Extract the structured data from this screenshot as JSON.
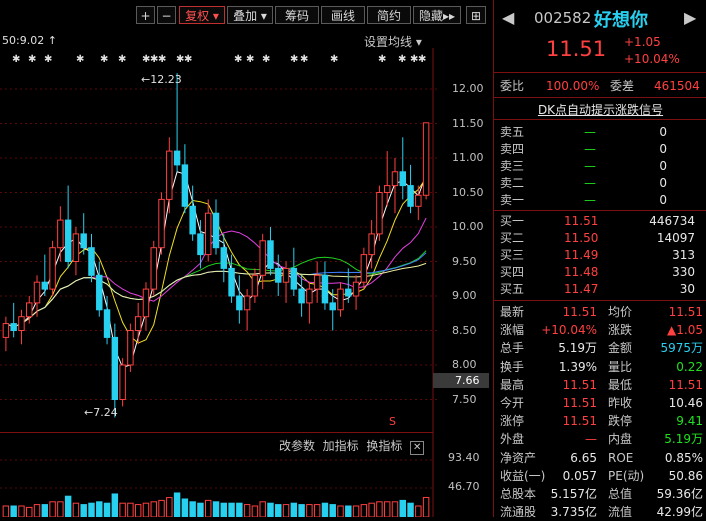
{
  "toolbar": {
    "zoom_in": "+",
    "zoom_out": "−",
    "fuquan": "复权",
    "diejia": "叠加",
    "chouma": "筹码",
    "huaxian": "画线",
    "jianyue": "简约",
    "yincang": "隐藏",
    "more": "▸▸",
    "layout": "⊞"
  },
  "chart": {
    "ma_label": "50:9.02",
    "ma_setting": "设置均线",
    "high_label": "12.23",
    "low_label": "7.24",
    "current_price_box": "7.66",
    "y_ticks": [
      "12.00",
      "11.50",
      "11.00",
      "10.50",
      "10.00",
      "9.50",
      "9.00",
      "8.50",
      "8.00",
      "7.50"
    ],
    "indicator_bar": [
      "改参数",
      "加指标",
      "换指标"
    ],
    "vol_ticks": [
      "93.40",
      "46.70"
    ],
    "s_marker": "S"
  },
  "chart_data": {
    "type": "candlestick",
    "title": "",
    "ylim": [
      7.0,
      12.5
    ],
    "annotations": [
      {
        "label": "12.23",
        "value": 12.23
      },
      {
        "label": "7.24",
        "value": 7.24
      }
    ],
    "candles": [
      {
        "o": 8.4,
        "h": 8.7,
        "l": 8.2,
        "c": 8.6
      },
      {
        "o": 8.6,
        "h": 8.9,
        "l": 8.4,
        "c": 8.5
      },
      {
        "o": 8.5,
        "h": 8.8,
        "l": 8.3,
        "c": 8.7
      },
      {
        "o": 8.7,
        "h": 9.0,
        "l": 8.6,
        "c": 8.9
      },
      {
        "o": 8.9,
        "h": 9.3,
        "l": 8.7,
        "c": 9.2
      },
      {
        "o": 9.2,
        "h": 9.6,
        "l": 9.0,
        "c": 9.1
      },
      {
        "o": 9.1,
        "h": 9.8,
        "l": 9.0,
        "c": 9.7
      },
      {
        "o": 9.7,
        "h": 10.3,
        "l": 9.5,
        "c": 10.1
      },
      {
        "o": 10.1,
        "h": 10.6,
        "l": 9.4,
        "c": 9.5
      },
      {
        "o": 9.5,
        "h": 10.0,
        "l": 9.3,
        "c": 9.9
      },
      {
        "o": 9.9,
        "h": 10.2,
        "l": 9.6,
        "c": 9.7
      },
      {
        "o": 9.7,
        "h": 9.9,
        "l": 9.2,
        "c": 9.3
      },
      {
        "o": 9.3,
        "h": 9.5,
        "l": 8.7,
        "c": 8.8
      },
      {
        "o": 8.8,
        "h": 9.0,
        "l": 8.3,
        "c": 8.4
      },
      {
        "o": 8.4,
        "h": 8.6,
        "l": 7.24,
        "c": 7.5
      },
      {
        "o": 7.5,
        "h": 8.1,
        "l": 7.4,
        "c": 8.0
      },
      {
        "o": 8.0,
        "h": 8.6,
        "l": 7.9,
        "c": 8.5
      },
      {
        "o": 8.5,
        "h": 8.9,
        "l": 8.3,
        "c": 8.7
      },
      {
        "o": 8.7,
        "h": 9.2,
        "l": 8.5,
        "c": 9.1
      },
      {
        "o": 9.1,
        "h": 9.8,
        "l": 9.0,
        "c": 9.7
      },
      {
        "o": 9.7,
        "h": 10.5,
        "l": 9.6,
        "c": 10.4
      },
      {
        "o": 10.4,
        "h": 11.3,
        "l": 10.2,
        "c": 11.1
      },
      {
        "o": 11.1,
        "h": 12.23,
        "l": 10.8,
        "c": 10.9
      },
      {
        "o": 10.9,
        "h": 11.2,
        "l": 10.2,
        "c": 10.3
      },
      {
        "o": 10.3,
        "h": 10.6,
        "l": 9.8,
        "c": 9.9
      },
      {
        "o": 9.9,
        "h": 10.1,
        "l": 9.4,
        "c": 9.6
      },
      {
        "o": 9.6,
        "h": 10.4,
        "l": 9.5,
        "c": 10.2
      },
      {
        "o": 10.2,
        "h": 10.4,
        "l": 9.6,
        "c": 9.7
      },
      {
        "o": 9.7,
        "h": 9.9,
        "l": 9.2,
        "c": 9.4
      },
      {
        "o": 9.4,
        "h": 9.6,
        "l": 8.9,
        "c": 9.0
      },
      {
        "o": 9.0,
        "h": 9.3,
        "l": 8.6,
        "c": 8.8
      },
      {
        "o": 8.8,
        "h": 9.1,
        "l": 8.5,
        "c": 9.0
      },
      {
        "o": 9.0,
        "h": 9.4,
        "l": 8.9,
        "c": 9.3
      },
      {
        "o": 9.3,
        "h": 9.9,
        "l": 9.1,
        "c": 9.8
      },
      {
        "o": 9.8,
        "h": 10.0,
        "l": 9.3,
        "c": 9.4
      },
      {
        "o": 9.4,
        "h": 9.6,
        "l": 9.0,
        "c": 9.2
      },
      {
        "o": 9.2,
        "h": 9.5,
        "l": 8.9,
        "c": 9.4
      },
      {
        "o": 9.4,
        "h": 9.7,
        "l": 9.0,
        "c": 9.1
      },
      {
        "o": 9.1,
        "h": 9.3,
        "l": 8.7,
        "c": 8.9
      },
      {
        "o": 8.9,
        "h": 9.2,
        "l": 8.6,
        "c": 9.1
      },
      {
        "o": 9.1,
        "h": 9.5,
        "l": 8.9,
        "c": 9.3
      },
      {
        "o": 9.3,
        "h": 9.5,
        "l": 8.8,
        "c": 8.9
      },
      {
        "o": 8.9,
        "h": 9.1,
        "l": 8.5,
        "c": 8.8
      },
      {
        "o": 8.8,
        "h": 9.2,
        "l": 8.7,
        "c": 9.1
      },
      {
        "o": 9.1,
        "h": 9.4,
        "l": 8.9,
        "c": 9.0
      },
      {
        "o": 9.0,
        "h": 9.3,
        "l": 8.8,
        "c": 9.2
      },
      {
        "o": 9.2,
        "h": 9.7,
        "l": 9.1,
        "c": 9.6
      },
      {
        "o": 9.6,
        "h": 10.1,
        "l": 9.4,
        "c": 9.9
      },
      {
        "o": 9.9,
        "h": 10.6,
        "l": 9.8,
        "c": 10.5
      },
      {
        "o": 10.5,
        "h": 11.1,
        "l": 10.3,
        "c": 10.6
      },
      {
        "o": 10.6,
        "h": 11.0,
        "l": 10.2,
        "c": 10.8
      },
      {
        "o": 10.8,
        "h": 11.3,
        "l": 10.4,
        "c": 10.6
      },
      {
        "o": 10.6,
        "h": 10.9,
        "l": 10.2,
        "c": 10.3
      },
      {
        "o": 10.3,
        "h": 10.6,
        "l": 10.1,
        "c": 10.46
      },
      {
        "o": 10.46,
        "h": 11.51,
        "l": 10.4,
        "c": 11.51
      }
    ],
    "volume_ticks": [
      93.4,
      46.7
    ]
  },
  "quote": {
    "code": "002582",
    "name": "好想你",
    "price": "11.51",
    "change": "+1.05",
    "change_pct": "+10.04%",
    "weibi_label": "委比",
    "weibi_value": "100.00%",
    "weicha_label": "委差",
    "weicha_value": "461504",
    "dk_link": "DK点自动提示涨跌信号",
    "sells": [
      {
        "label": "卖五",
        "price": "—",
        "vol": "0"
      },
      {
        "label": "卖四",
        "price": "—",
        "vol": "0"
      },
      {
        "label": "卖三",
        "price": "—",
        "vol": "0"
      },
      {
        "label": "卖二",
        "price": "—",
        "vol": "0"
      },
      {
        "label": "卖一",
        "price": "—",
        "vol": "0"
      }
    ],
    "buys": [
      {
        "label": "买一",
        "price": "11.51",
        "vol": "446734"
      },
      {
        "label": "买二",
        "price": "11.50",
        "vol": "14097"
      },
      {
        "label": "买三",
        "price": "11.49",
        "vol": "313"
      },
      {
        "label": "买四",
        "price": "11.48",
        "vol": "330"
      },
      {
        "label": "买五",
        "price": "11.47",
        "vol": "30"
      }
    ],
    "stats": [
      {
        "l1": "最新",
        "v1": "11.51",
        "l2": "均价",
        "v2": "11.51"
      },
      {
        "l1": "涨幅",
        "v1": "+10.04%",
        "l2": "涨跌",
        "v2": "▲1.05"
      },
      {
        "l1": "总手",
        "v1": "5.19万",
        "l2": "金额",
        "v2": "5975万"
      },
      {
        "l1": "换手",
        "v1": "1.39%",
        "l2": "量比",
        "v2": "0.22"
      },
      {
        "l1": "最高",
        "v1": "11.51",
        "l2": "最低",
        "v2": "11.51"
      },
      {
        "l1": "今开",
        "v1": "11.51",
        "l2": "昨收",
        "v2": "10.46"
      },
      {
        "l1": "涨停",
        "v1": "11.51",
        "l2": "跌停",
        "v2": "9.41"
      },
      {
        "l1": "外盘",
        "v1": "—",
        "l2": "内盘",
        "v2": "5.19万"
      },
      {
        "l1": "净资产",
        "v1": "6.65",
        "l2": "ROE",
        "v2": "0.85%"
      },
      {
        "l1": "收益(一)",
        "v1": "0.057",
        "l2": "PE(动)",
        "v2": "50.86"
      },
      {
        "l1": "总股本",
        "v1": "5.157亿",
        "l2": "总值",
        "v2": "59.36亿"
      },
      {
        "l1": "流通股",
        "v1": "3.735亿",
        "l2": "流值",
        "v2": "42.99亿"
      }
    ]
  },
  "colors": {
    "up": "#ff4040",
    "down": "#28d0f0",
    "frame": "#7a1010"
  }
}
